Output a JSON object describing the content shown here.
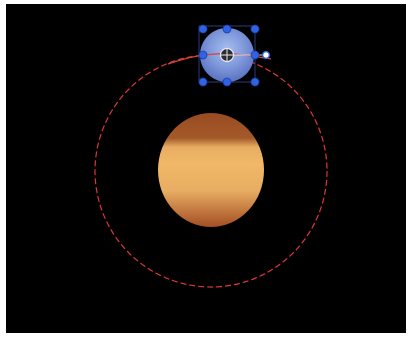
{
  "canvas": {
    "background": "#000000",
    "frame_background": "#ffffff"
  },
  "orbit_path": {
    "icon": "orbit-path-circle",
    "stroke_color": "#e0353a",
    "dash": "dashed"
  },
  "planet": {
    "icon": "planet",
    "colors": {
      "top": "#9a4a22",
      "band_dark": "#a35a2a",
      "middle": "#e8ad62",
      "bright": "#f1b868",
      "bottom": "#a44e24"
    }
  },
  "moon": {
    "icon": "moon",
    "colors": {
      "light": "#a9bff0",
      "mid": "#7e98da",
      "dark": "#5b73c3"
    }
  },
  "transform_handles": {
    "icon": "selection-handle",
    "color": "#2f63e3",
    "outline": "#1a3fa8",
    "bounding_box_color": "#2a3d7a",
    "rotation_handle_icon": "rotation-handle",
    "anchor_point_icon": "anchor-point-crosshair",
    "motion_path_color": "#d8433c"
  }
}
